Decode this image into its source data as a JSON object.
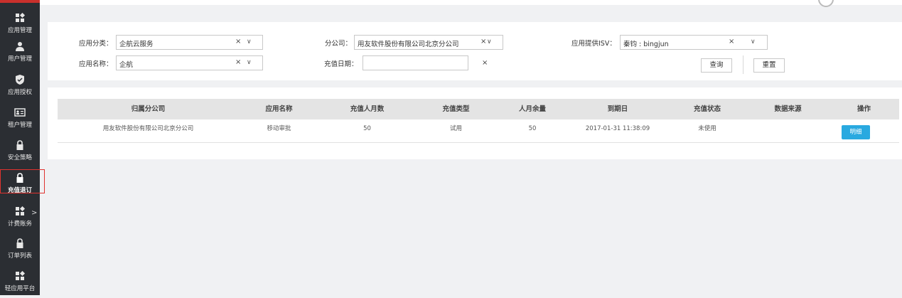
{
  "sidebar": {
    "items": [
      {
        "label": "应用管理",
        "icon": "grid-icon"
      },
      {
        "label": "用户管理",
        "icon": "user-icon"
      },
      {
        "label": "应用授权",
        "icon": "shield-icon"
      },
      {
        "label": "租户管理",
        "icon": "id-card-icon"
      },
      {
        "label": "安全策略",
        "icon": "lock-icon"
      },
      {
        "label": "充值退订",
        "icon": "lock-icon",
        "active": true
      },
      {
        "label": "计费账务",
        "icon": "grid-icon",
        "has_submenu": true
      },
      {
        "label": "订单列表",
        "icon": "lock-icon"
      },
      {
        "label": "轻应用平台",
        "icon": "grid-icon"
      }
    ],
    "submenu_arrow": ">"
  },
  "filters": {
    "category_label": "应用分类：",
    "category_value": "企航云服务",
    "branch_label": "分公司：",
    "branch_value": "用友软件股份有限公司北京分公司",
    "isv_label": "应用提供ISV：",
    "isv_value": "秦钧 : bingjun",
    "app_name_label": "应用名称：",
    "app_name_value": "企航",
    "date_label": "充值日期：",
    "date_value": "",
    "clear_symbol": "×",
    "caret_symbol": "∨",
    "query_button": "查询",
    "reset_button": "重置"
  },
  "table": {
    "columns": [
      "归属分公司",
      "应用名称",
      "充值人月数",
      "充值类型",
      "人月余量",
      "到期日",
      "充值状态",
      "数据来源",
      "操作"
    ],
    "rows": [
      {
        "branch": "用友软件股份有限公司北京分公司",
        "app_name": "移动审批",
        "months": "50",
        "type": "试用",
        "remaining": "50",
        "expiry": "2017-01-31 11:38:09",
        "status": "未使用",
        "source": "",
        "action": "明细"
      }
    ]
  },
  "colors": {
    "sidebar_bg": "#2b2e33",
    "active_outline": "#e0332f",
    "detail_button": "#29a9e0",
    "page_bg": "#f0f1f3",
    "table_header_bg": "#e4e4e4"
  }
}
